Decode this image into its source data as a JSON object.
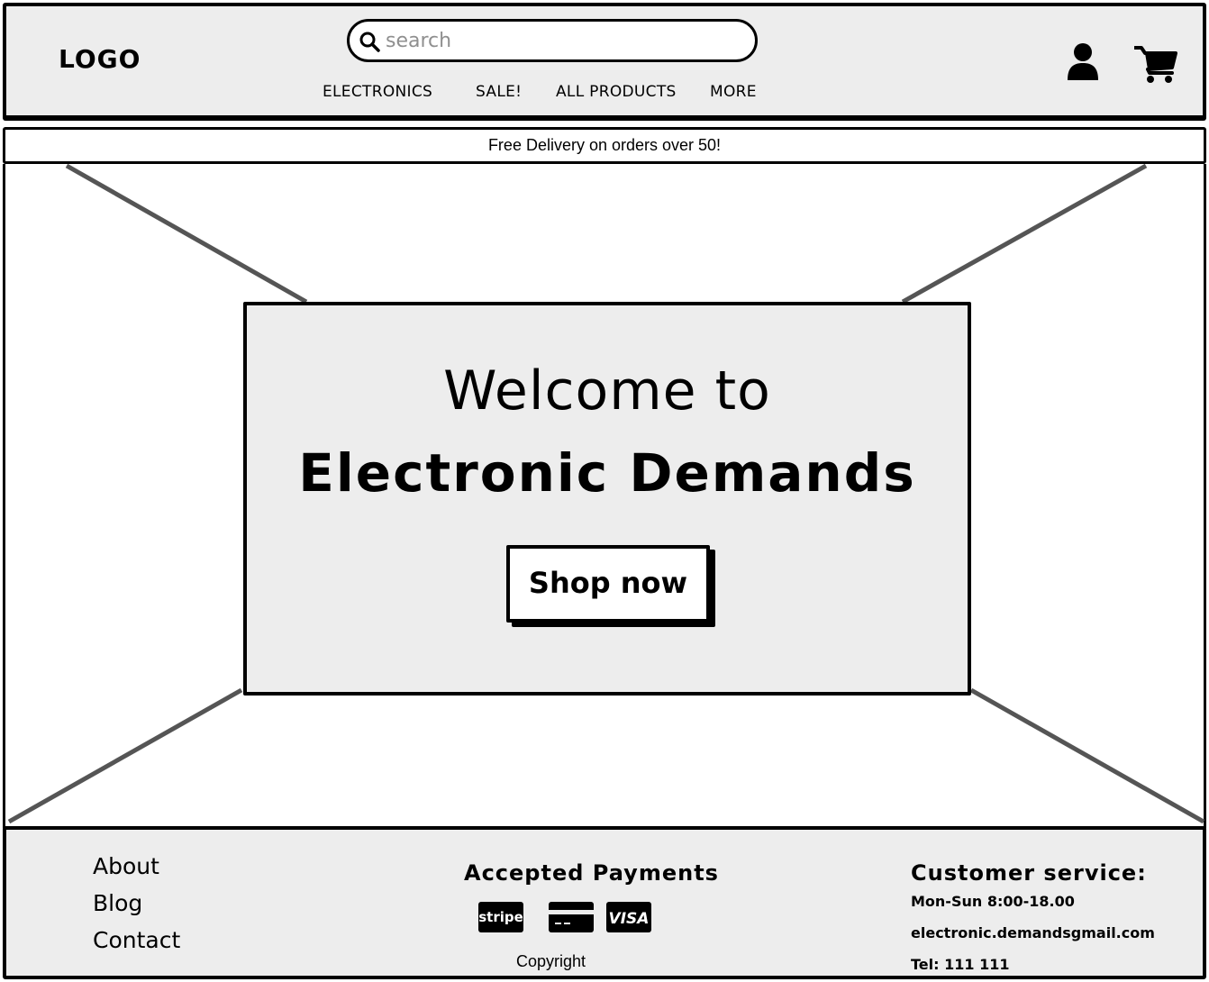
{
  "header": {
    "logo": "LOGO",
    "search": {
      "placeholder": "search",
      "value": ""
    },
    "nav": [
      "ELECTRONICS",
      "SALE!",
      "ALL PRODUCTS",
      "MORE"
    ]
  },
  "promo": {
    "text": "Free Delivery on orders over 50!"
  },
  "hero": {
    "line1": "Welcome to",
    "line2": "Electronic Demands",
    "button": "Shop now"
  },
  "footer": {
    "links": [
      "About",
      "Blog",
      "Contact"
    ],
    "payments": {
      "title": "Accepted Payments",
      "icons": [
        "stripe-icon",
        "credit-card-icon",
        "visa-icon"
      ],
      "stripe_label": "stripe",
      "visa_label": "VISA"
    },
    "copyright": "Copyright",
    "customer_service": {
      "title": "Customer service:",
      "hours": "Mon-Sun 8:00-18.00",
      "email": "electronic.demandsgmail.com",
      "phone": "Tel: 111 111"
    }
  },
  "colors": {
    "panel": "#ededed",
    "line": "#000000",
    "placeholder": "#8f8f8f",
    "diagonal": "#555555"
  }
}
